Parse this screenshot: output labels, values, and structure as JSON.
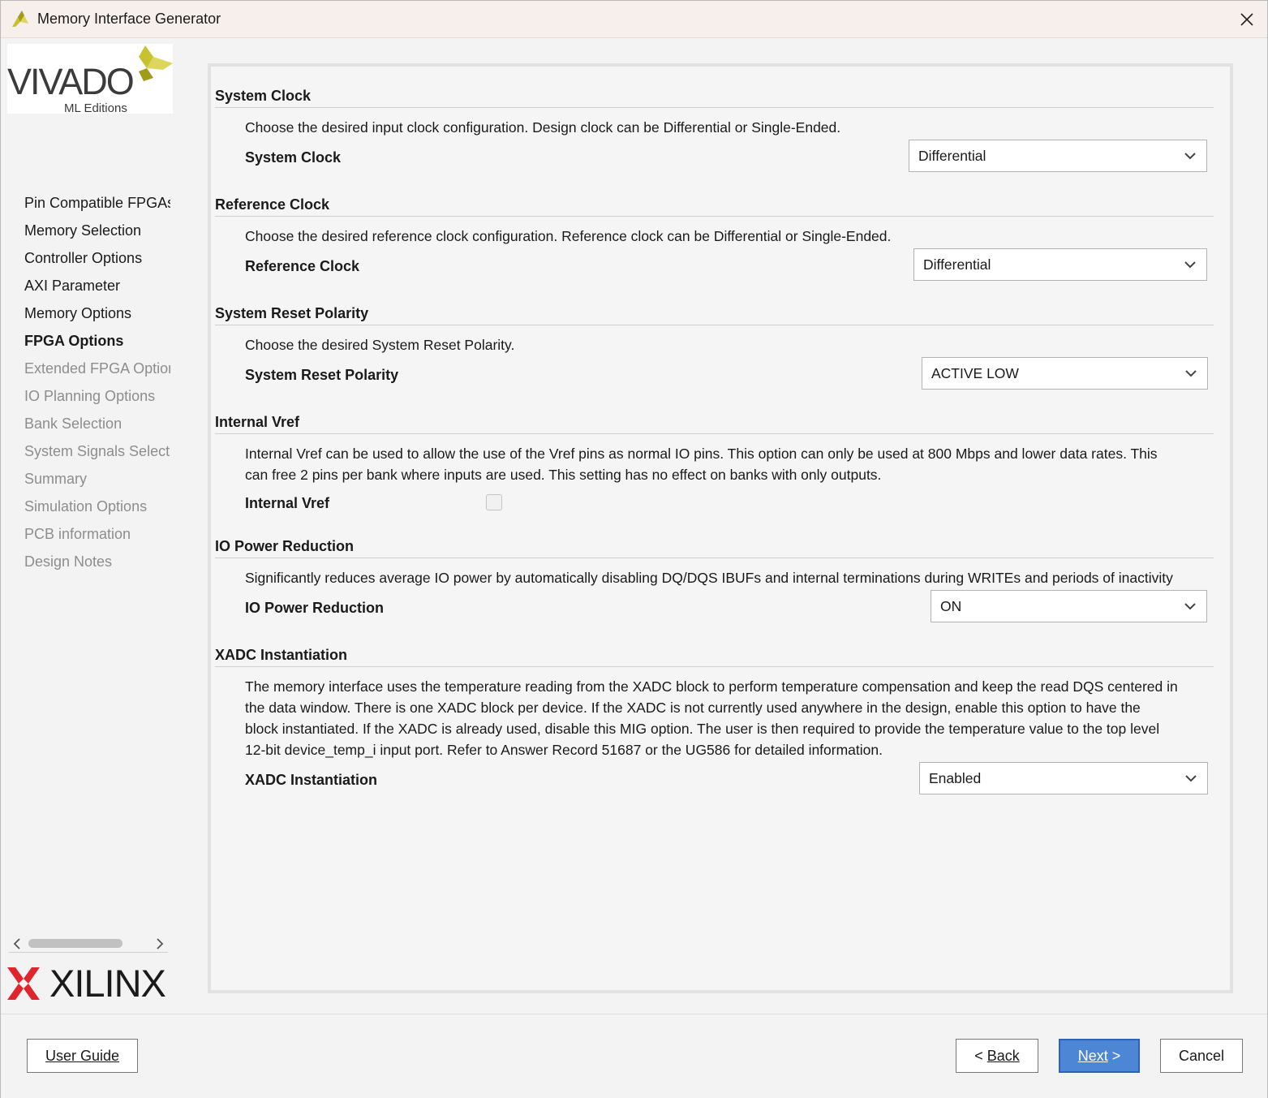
{
  "window": {
    "title": "Memory Interface Generator"
  },
  "branding": {
    "vivado": "VIVADO",
    "vivado_sub": "ML Editions",
    "xilinx": "XILINX",
    "vivado_color": "#c9c230",
    "xilinx_color": "#e0262c"
  },
  "sidebar": {
    "items": [
      {
        "label": "Pin Compatible FPGAs",
        "state": "normal"
      },
      {
        "label": "Memory Selection",
        "state": "normal"
      },
      {
        "label": "Controller Options",
        "state": "normal"
      },
      {
        "label": "AXI Parameter",
        "state": "normal"
      },
      {
        "label": "Memory Options",
        "state": "normal"
      },
      {
        "label": "FPGA Options",
        "state": "active"
      },
      {
        "label": "Extended FPGA Options",
        "state": "disabled"
      },
      {
        "label": "IO Planning Options",
        "state": "disabled"
      },
      {
        "label": "Bank Selection",
        "state": "disabled"
      },
      {
        "label": "System Signals Selection",
        "state": "disabled"
      },
      {
        "label": "Summary",
        "state": "disabled"
      },
      {
        "label": "Simulation Options",
        "state": "disabled"
      },
      {
        "label": "PCB information",
        "state": "disabled"
      },
      {
        "label": "Design Notes",
        "state": "disabled"
      }
    ]
  },
  "sections": {
    "system_clock": {
      "title": "System Clock",
      "description": "Choose the desired input clock configuration. Design clock can be Differential or Single-Ended.",
      "label": "System Clock",
      "value": "Differential"
    },
    "reference_clock": {
      "title": "Reference Clock",
      "description": "Choose the desired reference clock configuration. Reference clock can be Differential or Single-Ended.",
      "label": "Reference Clock",
      "value": "Differential"
    },
    "reset_polarity": {
      "title": "System Reset Polarity",
      "description": "Choose the desired System Reset Polarity.",
      "label": "System Reset Polarity",
      "value": "ACTIVE LOW"
    },
    "internal_vref": {
      "title": "Internal Vref",
      "description_line1": "Internal Vref can be used to allow the use of the Vref pins as normal IO pins. This option can only be used at 800 Mbps and lower data rates. This",
      "description_line2": "can free 2 pins per bank where inputs are used. This setting has no effect on banks with only outputs.",
      "label": "Internal Vref",
      "checked": false
    },
    "io_power": {
      "title": "IO Power Reduction",
      "description": "Significantly reduces average IO power by automatically disabling DQ/DQS IBUFs and internal terminations during WRITEs and periods of inactivity",
      "label": "IO Power Reduction",
      "value": "ON"
    },
    "xadc": {
      "title": "XADC Instantiation",
      "description_line1": "The memory interface uses the temperature reading from the XADC block to perform temperature compensation and keep the read DQS centered in",
      "description_line2": "the data window. There is one XADC block per device. If the XADC is not currently used anywhere in the design, enable this option to have the",
      "description_line3": "block instantiated. If the XADC is already used, disable this MIG option. The user is then required to provide the temperature value to the top level",
      "description_line4": "12-bit device_temp_i input port. Refer to Answer Record 51687 or the UG586 for detailed information.",
      "label": "XADC Instantiation",
      "value": "Enabled"
    }
  },
  "footer": {
    "user_guide": "User Guide",
    "back_prefix": "< ",
    "back_label": "Back",
    "next_label": "Next",
    "next_suffix": " >",
    "cancel": "Cancel"
  }
}
